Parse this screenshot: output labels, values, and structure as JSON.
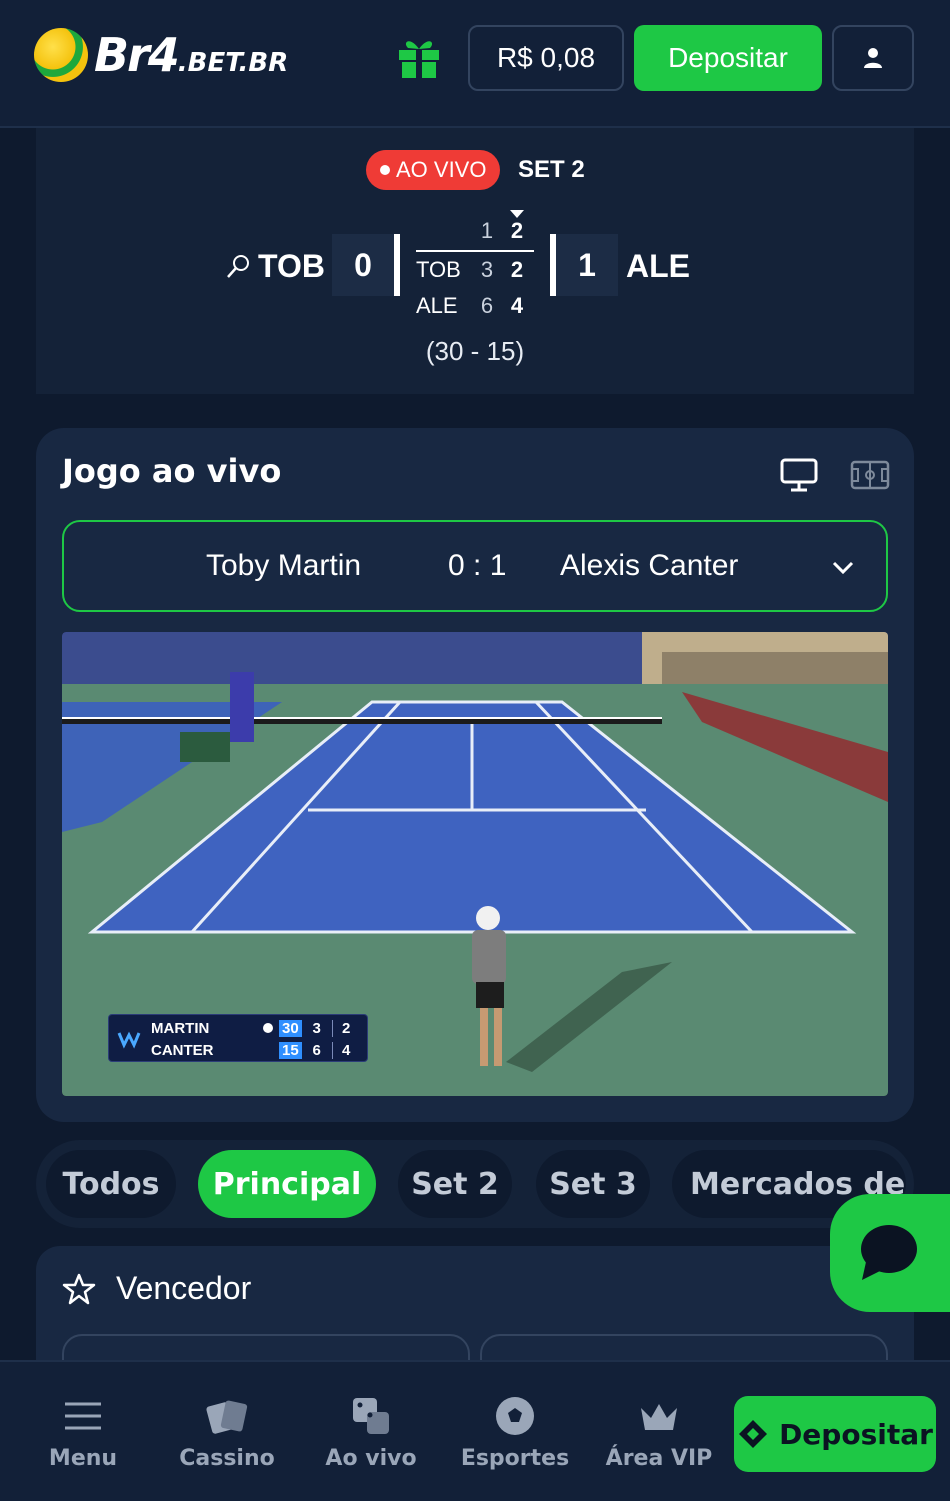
{
  "header": {
    "logo_main": "Br4",
    "logo_sub": ".BET.BR",
    "balance": "R$ 0,08",
    "deposit_label": "Depositar"
  },
  "scoreboard": {
    "live_label": "AO VIVO",
    "set_label": "SET 2",
    "team_left": "TOB",
    "team_right": "ALE",
    "sets_won_left": "0",
    "sets_won_right": "1",
    "set_headers": [
      "1",
      "2"
    ],
    "rows": [
      {
        "name": "TOB",
        "set1": "3",
        "set2": "2"
      },
      {
        "name": "ALE",
        "set1": "6",
        "set2": "4"
      }
    ],
    "game_score": "(30 - 15)"
  },
  "live_game": {
    "title": "Jogo ao vivo",
    "player1": "Toby Martin",
    "score": "0 : 1",
    "player2": "Alexis Canter",
    "overlay": {
      "p1": "MARTIN",
      "p1_points": "30",
      "p1_set1": "3",
      "p1_set2": "2",
      "p2": "CANTER",
      "p2_points": "15",
      "p2_set1": "6",
      "p2_set2": "4"
    }
  },
  "tabs": [
    "Todos",
    "Principal",
    "Set 2",
    "Set 3",
    "Mercados de"
  ],
  "active_tab": "Principal",
  "market": {
    "title": "Vencedor"
  },
  "bottom_nav": {
    "items": [
      "Menu",
      "Cassino",
      "Ao vivo",
      "Esportes",
      "Área VIP"
    ],
    "deposit_label": "Depositar"
  },
  "colors": {
    "background": "#0e1a2e",
    "panel": "#182842",
    "accent_green": "#1ec845",
    "live_red": "#ef3b36"
  }
}
